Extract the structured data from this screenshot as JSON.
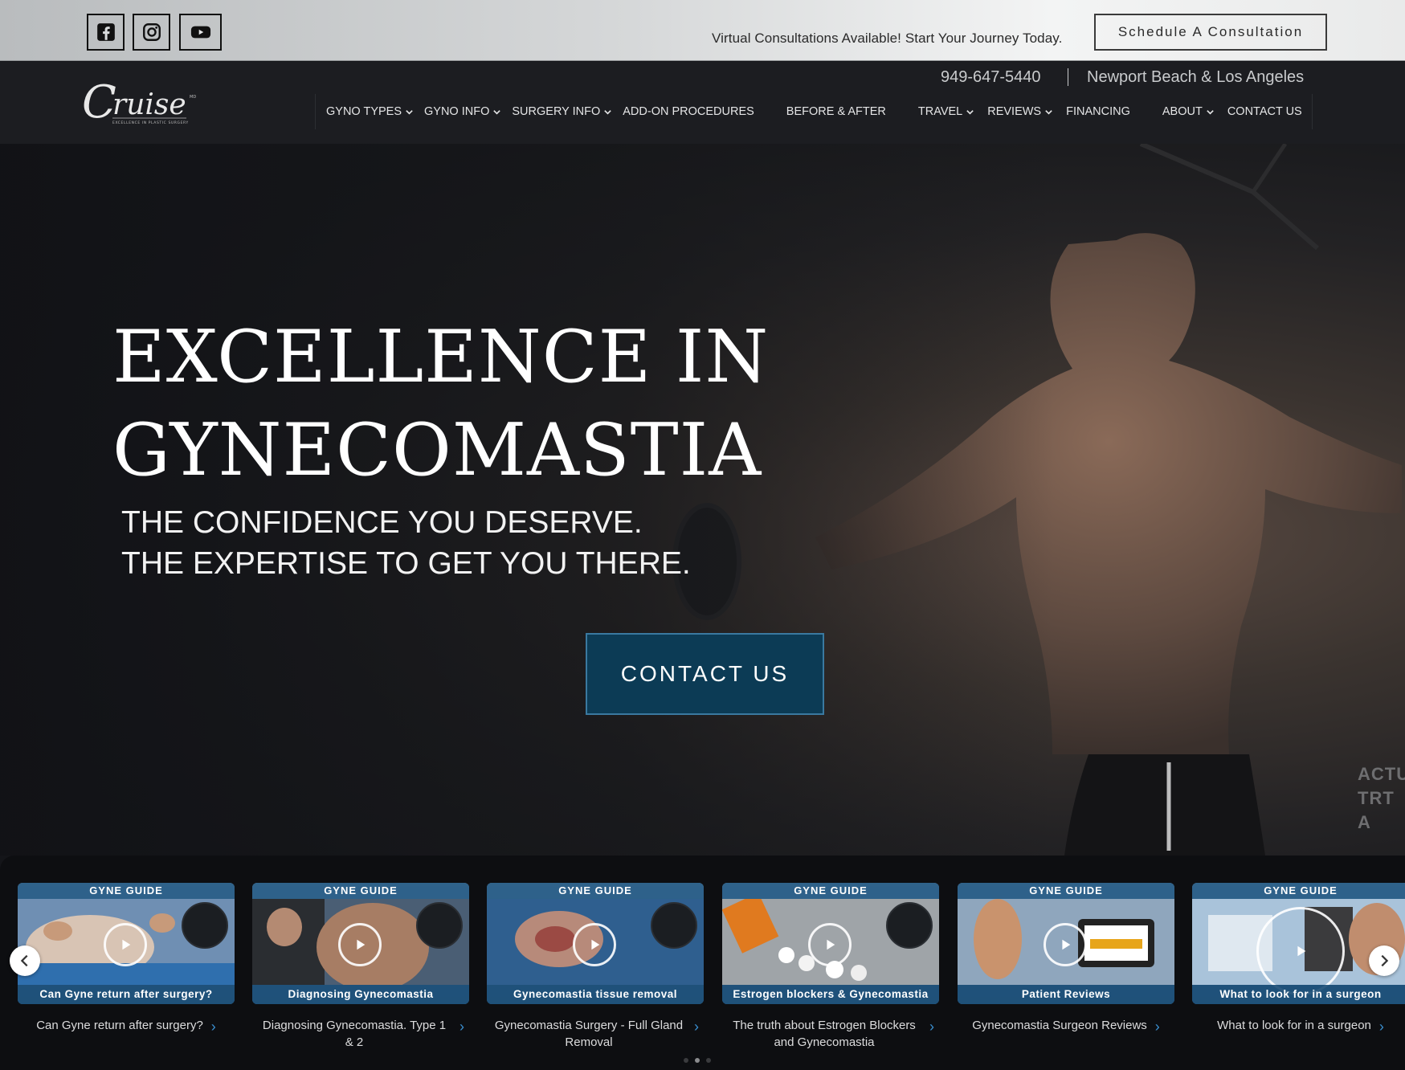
{
  "topbar": {
    "social": [
      "facebook-icon",
      "instagram-icon",
      "youtube-icon"
    ],
    "virtual_text": "Virtual Consultations Available! Start Your Journey Today.",
    "schedule_label": "Schedule A Consultation"
  },
  "header": {
    "logo_alt": "Cruise",
    "phone": "949-647-5440",
    "location": "Newport Beach & Los Angeles"
  },
  "nav": {
    "items": [
      {
        "label": "GYNO TYPES",
        "dropdown": true
      },
      {
        "label": "GYNO INFO",
        "dropdown": true
      },
      {
        "label": "SURGERY INFO",
        "dropdown": true
      },
      {
        "label": "ADD-ON PROCEDURES",
        "dropdown": false
      },
      {
        "label": "BEFORE & AFTER",
        "dropdown": false
      },
      {
        "label": "TRAVEL",
        "dropdown": true
      },
      {
        "label": "REVIEWS",
        "dropdown": true
      },
      {
        "label": "FINANCING",
        "dropdown": false
      },
      {
        "label": "ABOUT",
        "dropdown": true
      },
      {
        "label": "CONTACT US",
        "dropdown": false
      }
    ]
  },
  "hero": {
    "title_line1": "EXCELLENCE IN",
    "title_line2": "GYNECOMASTIA",
    "subtitle_line1": "THE CONFIDENCE YOU DESERVE.",
    "subtitle_line2": "THE EXPERTISE TO GET YOU THERE.",
    "cta_label": "CONTACT US",
    "side_line1": "ACTU",
    "side_line2": "TRT A"
  },
  "videos": {
    "items": [
      {
        "band": "GYNE GUIDE",
        "overlay": "Can Gyne return after surgery?",
        "caption": "Can Gyne return after surgery?"
      },
      {
        "band": "GYNE GUIDE",
        "overlay": "Diagnosing Gynecomastia",
        "caption": "Diagnosing Gynecomastia. Type 1 & 2"
      },
      {
        "band": "GYNE GUIDE",
        "overlay": "Gynecomastia tissue removal",
        "caption": "Gynecomastia Surgery - Full Gland Removal"
      },
      {
        "band": "GYNE GUIDE",
        "overlay": "Estrogen blockers & Gynecomastia",
        "caption": "The truth about Estrogen Blockers and Gynecomastia"
      },
      {
        "band": "GYNE GUIDE",
        "overlay": "Patient Reviews",
        "caption": "Gynecomastia Surgeon Reviews"
      },
      {
        "band": "GYNE GUIDE",
        "overlay": "What to look for in a surgeon",
        "caption": "What to look for in a surgeon"
      }
    ],
    "page_dots": 3,
    "active_dot": 1
  },
  "colors": {
    "cta_bg": "#0c3b55",
    "nav_bg": "#1c1d21",
    "accent_arrow": "#3a8fd0"
  }
}
